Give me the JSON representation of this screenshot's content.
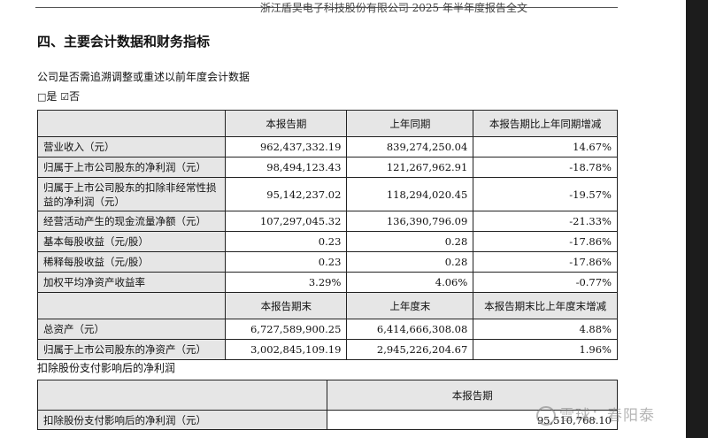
{
  "header": {
    "text": "浙江盾昊电子科技股份有限公司 2025 年半年度报告全文"
  },
  "section_title": "四、主要会计数据和财务指标",
  "question": "公司是否需追溯调整或重述以前年度会计数据",
  "options": {
    "no_box": "□",
    "yes_text": "是",
    "checked_box": "☑",
    "no_text": "否"
  },
  "table": {
    "header1": [
      "",
      "本报告期",
      "上年同期",
      "本报告期比上年同期增减"
    ],
    "rows1": [
      [
        "营业收入（元）",
        "962,437,332.19",
        "839,274,250.04",
        "14.67%"
      ],
      [
        "归属于上市公司股东的净利润（元）",
        "98,494,123.43",
        "121,267,962.91",
        "-18.78%"
      ],
      [
        "归属于上市公司股东的扣除非经常性损益的净利润（元）",
        "95,142,237.02",
        "118,294,020.45",
        "-19.57%"
      ],
      [
        "经营活动产生的现金流量净额（元）",
        "107,297,045.32",
        "136,390,796.09",
        "-21.33%"
      ],
      [
        "基本每股收益（元/股）",
        "0.23",
        "0.28",
        "-17.86%"
      ],
      [
        "稀释每股收益（元/股）",
        "0.23",
        "0.28",
        "-17.86%"
      ],
      [
        "加权平均净资产收益率",
        "3.29%",
        "4.06%",
        "-0.77%"
      ]
    ],
    "header2": [
      "",
      "本报告期末",
      "上年度末",
      "本报告期末比上年度末增减"
    ],
    "rows2": [
      [
        "总资产（元）",
        "6,727,589,900.25",
        "6,414,666,308.08",
        "4.88%"
      ],
      [
        "归属于上市公司股东的净资产（元）",
        "3,002,845,109.19",
        "2,945,226,204.67",
        "1.96%"
      ]
    ]
  },
  "sub_title": "扣除股份支付影响后的净利润",
  "table2": {
    "header": [
      "",
      "本报告期"
    ],
    "row": [
      "扣除股份支付影响后的净利润（元）",
      "95,510,768.10"
    ]
  },
  "watermark": "雪球：春阳泰"
}
